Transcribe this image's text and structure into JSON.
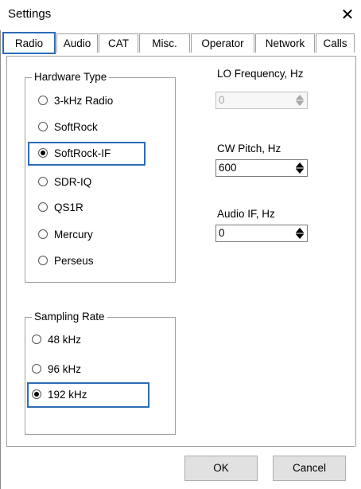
{
  "window": {
    "title": "Settings"
  },
  "tabs": [
    {
      "label": "Radio"
    },
    {
      "label": "Audio"
    },
    {
      "label": "CAT"
    },
    {
      "label": "Misc."
    },
    {
      "label": "Operator"
    },
    {
      "label": "Network"
    },
    {
      "label": "Calls"
    }
  ],
  "hardware": {
    "legend": "Hardware Type",
    "options": [
      {
        "label": "3-kHz Radio",
        "selected": false
      },
      {
        "label": "SoftRock",
        "selected": false
      },
      {
        "label": "SoftRock-IF",
        "selected": true
      },
      {
        "label": "SDR-IQ",
        "selected": false
      },
      {
        "label": "QS1R",
        "selected": false
      },
      {
        "label": "Mercury",
        "selected": false
      },
      {
        "label": "Perseus",
        "selected": false
      }
    ]
  },
  "sampling": {
    "legend": "Sampling Rate",
    "options": [
      {
        "label": "48 kHz",
        "selected": false
      },
      {
        "label": "96 kHz",
        "selected": false
      },
      {
        "label": "192 kHz",
        "selected": true
      }
    ]
  },
  "fields": {
    "lo_frequency": {
      "label": "LO Frequency, Hz",
      "value": "0",
      "enabled": false
    },
    "cw_pitch": {
      "label": "CW Pitch, Hz",
      "value": "600",
      "enabled": true
    },
    "audio_if": {
      "label": "Audio IF, Hz",
      "value": "0",
      "enabled": true
    }
  },
  "buttons": {
    "ok": "OK",
    "cancel": "Cancel"
  },
  "icons": {
    "close": "close-icon",
    "spin": "spin-updown-icon"
  },
  "colors": {
    "focus": "#2a6cb8",
    "border": "#a0a0a0",
    "button_face": "#e1e1e1"
  }
}
